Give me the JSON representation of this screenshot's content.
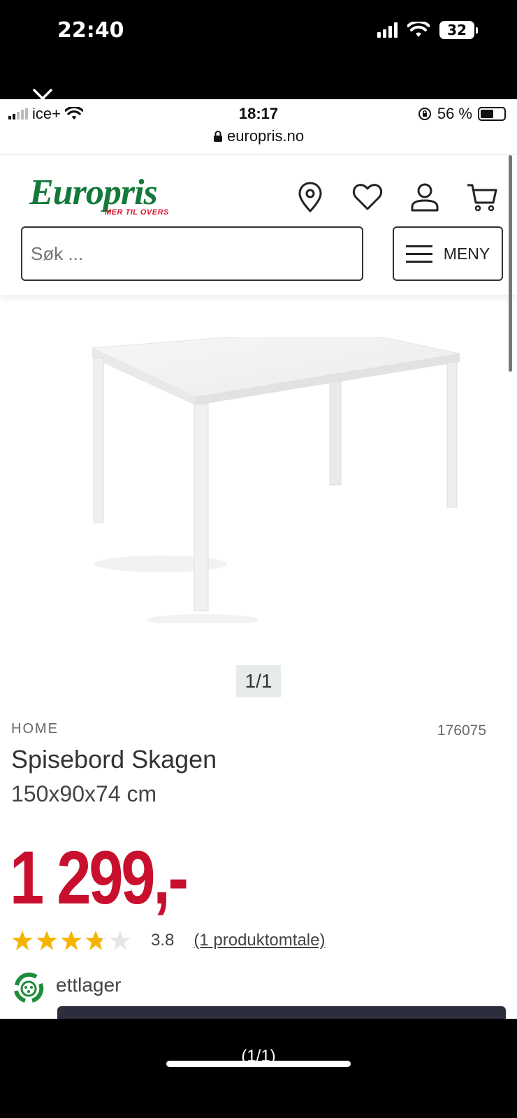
{
  "outer_status": {
    "time": "22:40",
    "battery": "32"
  },
  "inner_status": {
    "carrier": "ice+",
    "time": "18:17",
    "url": "europris.no",
    "battery": "56 %"
  },
  "header": {
    "logo_text": "Europris",
    "logo_tagline": "MER TIL OVERS",
    "search_placeholder": "Søk ...",
    "menu_label": "MENY",
    "icons": [
      "location-icon",
      "heart-icon",
      "user-icon",
      "cart-icon"
    ]
  },
  "product": {
    "image_pager": "1/1",
    "brand": "HOME",
    "sku": "176075",
    "title": "Spisebord Skagen",
    "dimensions": "150x90x74 cm",
    "price": "1 299,-",
    "rating": 3.8,
    "rating_text": "3.8",
    "reviews_link": "(1 produktomtale)",
    "stock_text": "ettlager"
  },
  "viewer": {
    "counter": "(1/1)"
  },
  "colors": {
    "brand_green": "#137a3c",
    "price_red": "#c8102e",
    "star": "#f5b400"
  }
}
